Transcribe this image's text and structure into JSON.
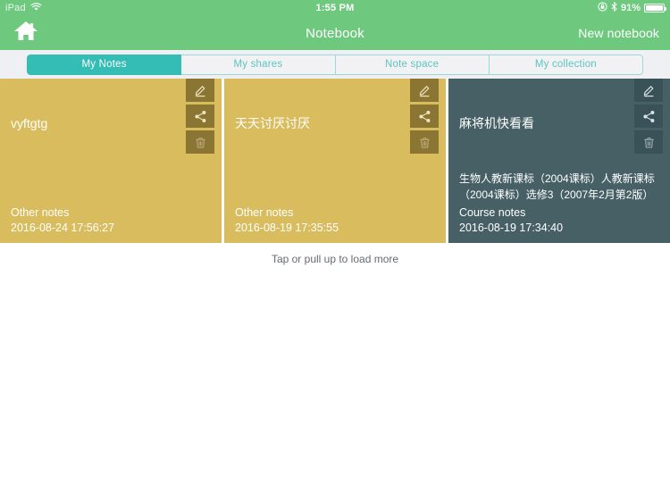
{
  "statusbar": {
    "device": "iPad",
    "wifi_icon": "wifi-icon",
    "time": "1:55 PM",
    "rotation_lock_icon": "rotation-lock-icon",
    "bluetooth_icon": "bluetooth-icon",
    "battery_percent": "91%",
    "battery_icon": "battery-icon"
  },
  "navbar": {
    "home_icon": "home-icon",
    "title": "Notebook",
    "new_notebook_label": "New notebook"
  },
  "tabs": [
    {
      "label": "My Notes",
      "active": true
    },
    {
      "label": "My shares",
      "active": false
    },
    {
      "label": "Note space",
      "active": false
    },
    {
      "label": "My collection",
      "active": false
    }
  ],
  "notes": [
    {
      "title": "vyftgtg",
      "subtitle": "",
      "category": "Other notes",
      "date": "2016-08-24 17:56:27",
      "theme": "gold",
      "actions": [
        "edit-icon",
        "share-icon",
        "delete-icon"
      ]
    },
    {
      "title": "天天讨厌讨厌",
      "subtitle": "",
      "category": "Other notes",
      "date": "2016-08-19 17:35:55",
      "theme": "gold",
      "actions": [
        "edit-icon",
        "share-icon",
        "delete-icon"
      ]
    },
    {
      "title": "麻将机快看看",
      "subtitle": "生物人教新课标（2004课标）人教新课标（2004课标）选修3（2007年2月第2版）",
      "category": "Course notes",
      "date": "2016-08-19 17:34:40",
      "theme": "slate",
      "actions": [
        "edit-icon",
        "share-icon",
        "delete-icon"
      ]
    }
  ],
  "footer": {
    "load_more_label": "Tap or pull up to load more"
  },
  "colors": {
    "header_green": "#6ec87e",
    "tab_active_teal": "#34bdb4",
    "tab_inactive_bg": "#f2f2f5",
    "tab_text_teal": "#5bc5bd",
    "card_gold": "#d8bc5e",
    "card_slate": "#466066",
    "action_gold": "#8a7632",
    "action_slate": "#3a5158",
    "strip_bg": "#eff0f4",
    "page_bg": "#ffffff"
  }
}
